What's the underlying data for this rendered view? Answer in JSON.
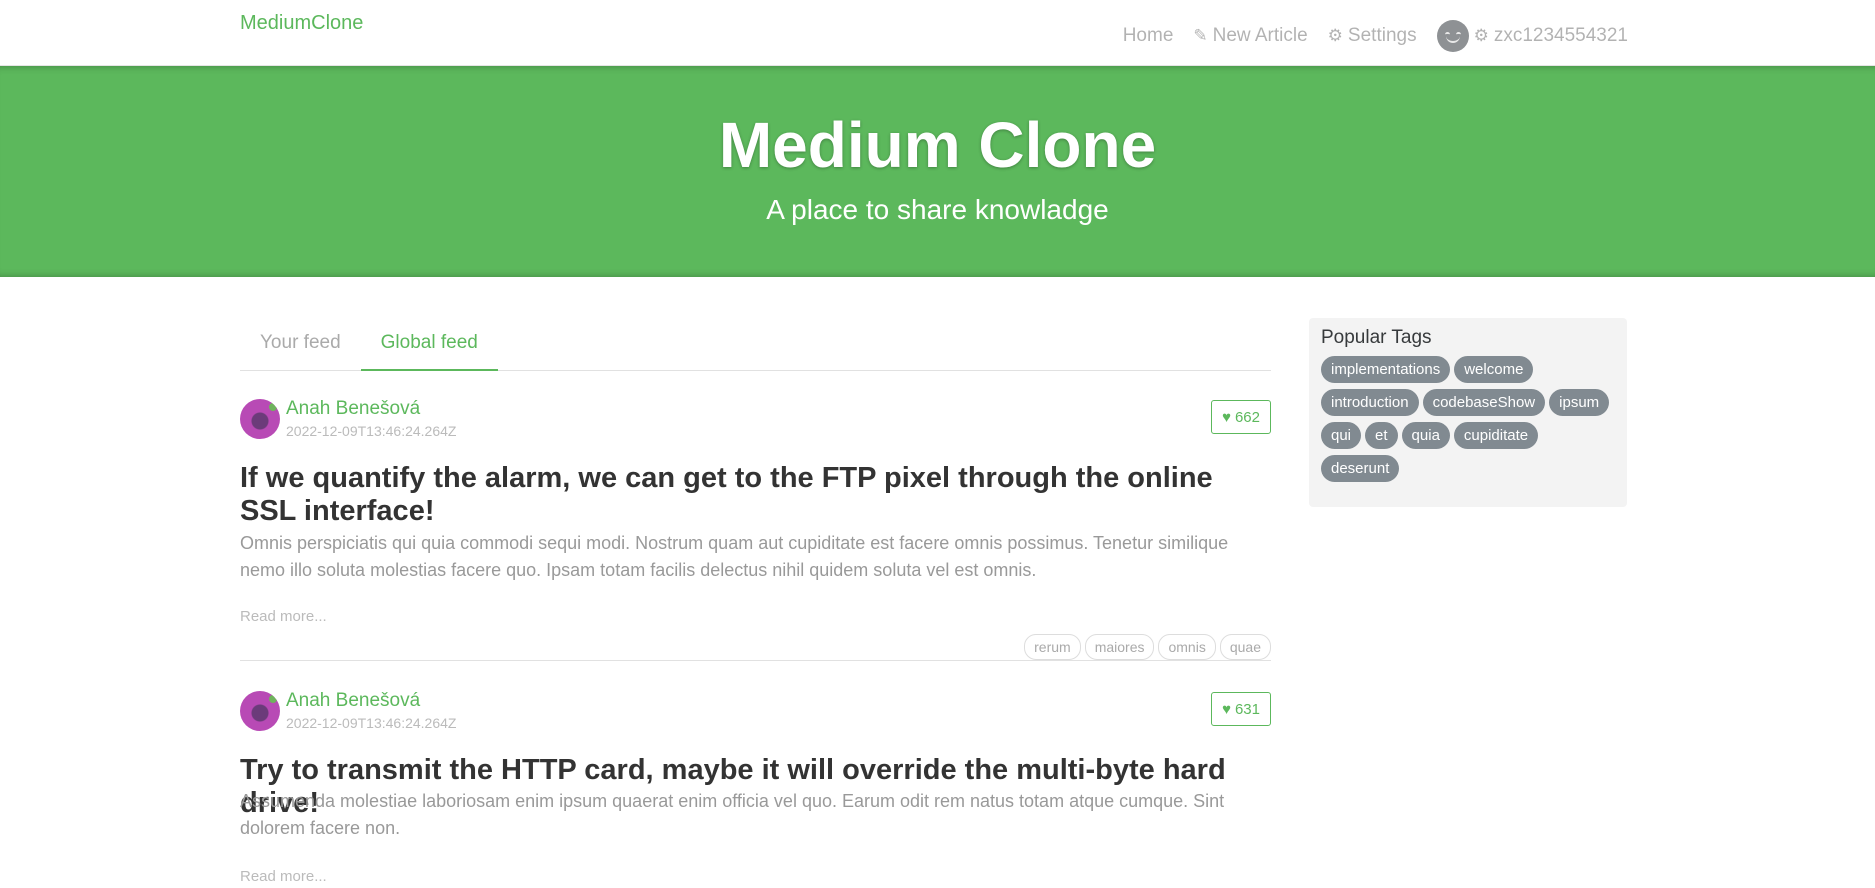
{
  "navbar": {
    "brand": "MediumClone",
    "links": {
      "home": "Home",
      "new_article": "New Article",
      "settings": "Settings",
      "username": "zxc1234554321"
    }
  },
  "banner": {
    "title": "Medium Clone",
    "subtitle": "A place to share knowladge"
  },
  "feed_tabs": {
    "your_feed": "Your feed",
    "global_feed": "Global feed"
  },
  "articles": [
    {
      "author": "Anah Benešová",
      "date": "2022-12-09T13:46:24.264Z",
      "favorites": "662",
      "title": "If we quantify the alarm, we can get to the FTP pixel through the online SSL interface!",
      "description": "Omnis perspiciatis qui quia commodi sequi modi. Nostrum quam aut cupiditate est facere omnis possimus. Tenetur similique nemo illo soluta molestias facere quo. Ipsam totam facilis delectus nihil quidem soluta vel est omnis.",
      "read_more": "Read more...",
      "tags": [
        "rerum",
        "maiores",
        "omnis",
        "quae"
      ]
    },
    {
      "author": "Anah Benešová",
      "date": "2022-12-09T13:46:24.264Z",
      "favorites": "631",
      "title": "Try to transmit the HTTP card, maybe it will override the multi-byte hard drive!",
      "description": "Assumenda molestiae laboriosam enim ipsum quaerat enim officia vel quo. Earum odit rem natus totam atque cumque. Sint dolorem facere non.",
      "read_more": "Read more..."
    }
  ],
  "sidebar": {
    "title": "Popular Tags",
    "tags": [
      "implementations",
      "welcome",
      "introduction",
      "codebaseShow",
      "ipsum",
      "qui",
      "et",
      "quia",
      "cupiditate",
      "deserunt"
    ]
  },
  "colors": {
    "brand_green": "#5cb85c",
    "tag_pill_gray": "#818a91"
  }
}
